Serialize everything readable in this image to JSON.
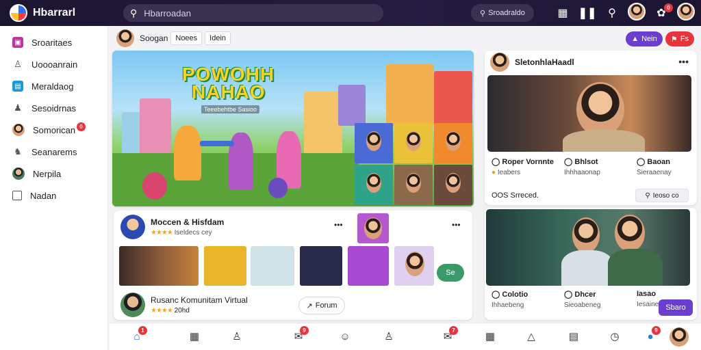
{
  "app": {
    "title": "Hbarrarl"
  },
  "search": {
    "placeholder": "Hbarroadan",
    "secondary_label": "Sroadraldo"
  },
  "topbar": {
    "notif_badge": "0"
  },
  "sidebar": {
    "items": [
      {
        "label": "Sroaritaes",
        "icon": "camera-icon",
        "color": "#c0359b"
      },
      {
        "label": "Uoooanrain",
        "icon": "user-icon",
        "color": "#555555"
      },
      {
        "label": "Meraldaog",
        "icon": "image-icon",
        "color": "#1a9ad6"
      },
      {
        "label": "Sesoidrnas",
        "icon": "group-icon",
        "color": "#555555"
      },
      {
        "label": "Somorican",
        "icon": "avatar-icon",
        "color": "#e08a2c",
        "badge": "0"
      },
      {
        "label": "Seanarems",
        "icon": "people-icon",
        "color": "#555555"
      },
      {
        "label": "Nerpila",
        "icon": "avatar-icon",
        "color": "#3a7a4a"
      },
      {
        "label": "Nadan",
        "icon": "bookmark-icon",
        "color": "#555555"
      }
    ]
  },
  "subbar": {
    "user": "Soogan",
    "chips": [
      "Noees",
      "Idein"
    ],
    "btn_primary": "Nein",
    "btn_danger": "Fs"
  },
  "hero": {
    "title_line1": "POWOHH",
    "title_line2": "NAHAO",
    "subtitle": "Teeebehtbe Sasioo"
  },
  "person_card": {
    "name": "SletonhlaHaadl",
    "stats": [
      {
        "title": "Roper Vornnte",
        "sub": "Ieabers"
      },
      {
        "title": "Bhlsot",
        "sub": "Ihhhaaonap"
      },
      {
        "title": "Baoan",
        "sub": "Sieraaenay"
      }
    ],
    "footer": "OOS Srreced.",
    "tag": "Ieoso co"
  },
  "group_card": {
    "title": "Moccen & Hisfdam",
    "subtitle": "Iseldecs cey",
    "btn_label": "Se",
    "member_name": "Rusanc Komunitam Virtual",
    "member_sub": "20hd",
    "forum_label": "Forum"
  },
  "person_card2": {
    "stats": [
      {
        "title": "Colotio",
        "sub": "Ihhaebeng"
      },
      {
        "title": "Dhcer",
        "sub": "Sieoabeneg"
      },
      {
        "title": "Iasao",
        "sub": "Iesainenue"
      }
    ],
    "btn_label": "Sbaro"
  },
  "bottomnav": {
    "badges": [
      "1",
      "9",
      "7",
      "9"
    ]
  },
  "colors": {
    "topbar": "#1c1530",
    "primary_purple": "#6a3fd0",
    "danger_red": "#e8343c",
    "accent_green": "#3a9a6a"
  }
}
